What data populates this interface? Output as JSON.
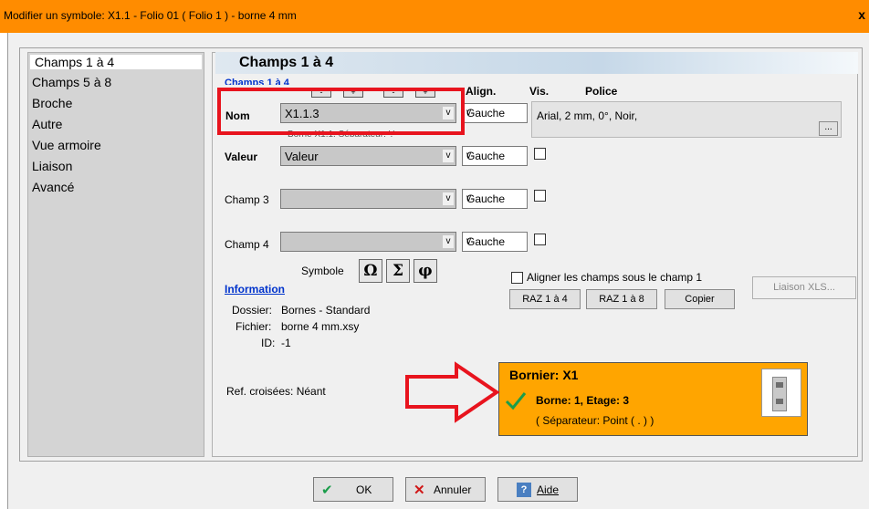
{
  "window": {
    "title": "Modifier un symbole: X1.1 - Folio 01 ( Folio 1 ) - borne 4 mm",
    "close": "x"
  },
  "nav": {
    "items": [
      "Champs 1 à 4",
      "Champs 5 à 8",
      "Broche",
      "Autre",
      "Vue armoire",
      "Liaison",
      "Avancé"
    ]
  },
  "panel": {
    "title": "Champs 1 à 4",
    "section": "Champs 1 à 4",
    "headers": {
      "align": "Align.",
      "vis": "Vis.",
      "police": "Police"
    },
    "step": {
      "minus": "-",
      "plus": "+"
    },
    "rows": [
      {
        "label": "Nom",
        "value": "X1.1.3",
        "align": "Gauche",
        "checked": "✔"
      },
      {
        "label": "Valeur",
        "value": "Valeur",
        "align": "Gauche",
        "checked": ""
      },
      {
        "label": "Champ 3",
        "value": "",
        "align": "Gauche",
        "checked": ""
      },
      {
        "label": "Champ 4",
        "value": "",
        "align": "Gauche",
        "checked": ""
      }
    ],
    "hint": "Borne X1.1. Séparateur: '.'",
    "police": {
      "value": "Arial, 2 mm, 0°, Noir,",
      "button": "..."
    },
    "symbole": {
      "label": "Symbole",
      "buttons": [
        "Ω",
        "Σ",
        "φ"
      ]
    },
    "info": {
      "title": "Information",
      "dossier_label": "Dossier:",
      "dossier": "Bornes - Standard",
      "fichier_label": "Fichier:",
      "fichier": "borne 4 mm.xsy",
      "id_label": "ID:",
      "id": "-1"
    },
    "align_all": "Aligner les champs sous le champ 1",
    "buttons": {
      "raz4": "RAZ 1 à 4",
      "raz8": "RAZ 1 à 8",
      "copier": "Copier",
      "liaison": "Liaison XLS..."
    },
    "refs": "Ref. croisées: Néant",
    "bornier": {
      "title": "Bornier: X1",
      "line": "Borne: 1, Etage: 3",
      "sep": "( Séparateur: Point ( . ) )"
    }
  },
  "footer": {
    "ok": "OK",
    "cancel": "Annuler",
    "help": "Aide"
  },
  "colors": {
    "titlebar": "#ff8c00",
    "highlight": "#e8141e",
    "bornier": "#ffa500",
    "link": "#0033cc"
  }
}
